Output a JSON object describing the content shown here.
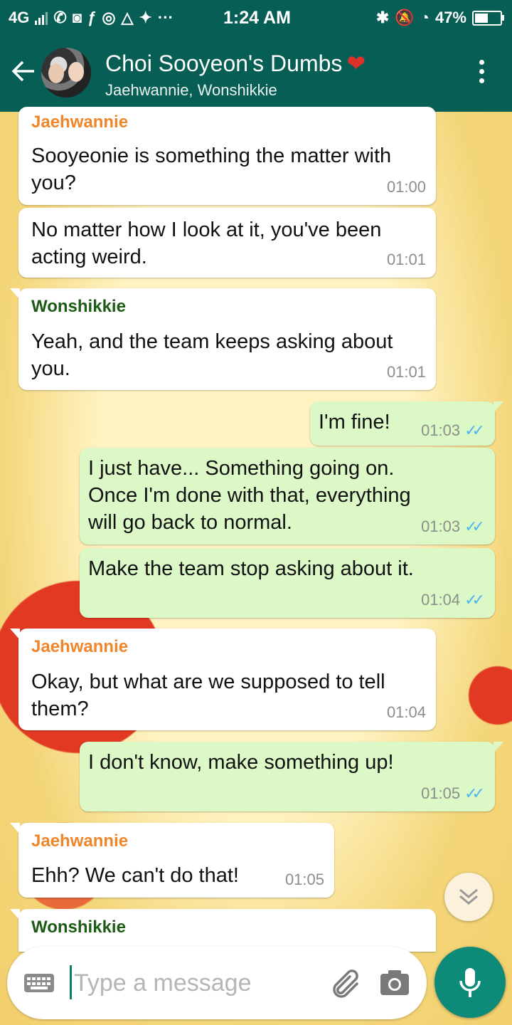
{
  "status_bar": {
    "network": "4G",
    "time": "1:24 AM",
    "more": "···",
    "battery_text": "47%",
    "battery_level": 0.47
  },
  "header": {
    "title": "Choi Sooyeon's Dumbs",
    "heart": "❤",
    "subtitle": "Jaehwannie, Wonshikkie"
  },
  "messages": [
    {
      "dir": "in",
      "sender": "Jaehwannie",
      "text": "Sooyeonie is something the matter with you?",
      "time": "01:00"
    },
    {
      "dir": "in",
      "sender": "",
      "text": "No matter how I look at it, you've been acting weird.",
      "time": "01:01"
    },
    {
      "dir": "in",
      "sender": "Wonshikkie",
      "text": "Yeah, and the team keeps asking about you.",
      "time": "01:01"
    },
    {
      "dir": "out",
      "text": "I'm fine!",
      "time": "01:03"
    },
    {
      "dir": "out",
      "text": "I just have... Something going on. Once I'm done with that, everything will go back to normal.",
      "time": "01:03"
    },
    {
      "dir": "out",
      "text": "Make the team stop asking about it.",
      "time": "01:04"
    },
    {
      "dir": "in",
      "sender": "Jaehwannie",
      "text": "Okay, but what are we supposed to tell them?",
      "time": "01:04"
    },
    {
      "dir": "out",
      "text": "I don't know, make something up!",
      "time": "01:05"
    },
    {
      "dir": "in",
      "sender": "Jaehwannie",
      "text": "Ehh? We can't do that!",
      "time": "01:05"
    },
    {
      "dir": "in",
      "sender": "Wonshikkie",
      "text": "",
      "time": ""
    }
  ],
  "input": {
    "placeholder": "Type a message"
  },
  "icons": {
    "back": "arrow-back-icon",
    "menu": "more-vertical-icon",
    "scroll": "chevron-double-down-icon",
    "keyboard": "keyboard-icon",
    "attach": "paperclip-icon",
    "camera": "camera-icon",
    "mic": "microphone-icon"
  },
  "colors": {
    "header": "#075e54",
    "outgoing_bubble": "#dcf8c6",
    "incoming_bubble": "#ffffff",
    "sender_jaehwannie": "#f0862a",
    "sender_wonshikkie": "#1d5a15",
    "read_ticks": "#4fb6ec",
    "mic_button": "#0e8a78"
  }
}
